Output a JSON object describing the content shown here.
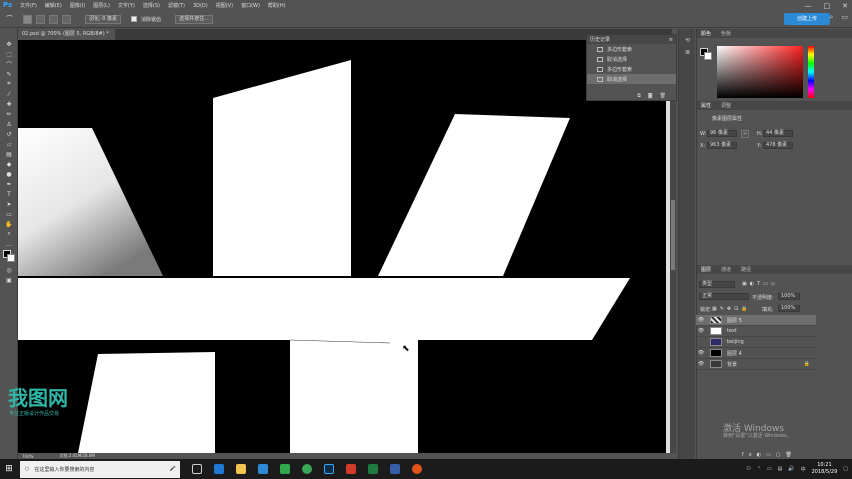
{
  "app": {
    "logo": "Ps"
  },
  "menu": [
    "文件(F)",
    "编辑(E)",
    "图像(I)",
    "图层(L)",
    "文字(Y)",
    "选择(S)",
    "滤镜(T)",
    "3D(D)",
    "视图(V)",
    "窗口(W)",
    "帮助(H)"
  ],
  "options": {
    "feather": "羽化: 0 像素",
    "antialias_label": "消除锯齿",
    "select_mask": "选择并遮住...",
    "cloud_button": "创建上传"
  },
  "document": {
    "tab": "02.psd @ 700% (图层 5, RGB/8#) *",
    "zoom": "700%",
    "doc_info": "文档:2.01M/28.6M"
  },
  "history": {
    "tabs": [
      "历史记录"
    ],
    "items": [
      {
        "label": "多边形套索",
        "icon": "lasso-icon",
        "selected": false
      },
      {
        "label": "取消选择",
        "icon": "doc-icon",
        "selected": false
      },
      {
        "label": "多边形套索",
        "icon": "lasso-icon",
        "selected": false
      },
      {
        "label": "取消选择",
        "icon": "doc-icon",
        "selected": true
      }
    ]
  },
  "color_panel": {
    "tabs": [
      "颜色",
      "色板"
    ]
  },
  "properties": {
    "tabs": [
      "属性",
      "调整"
    ],
    "heading": "像素图层属性",
    "w_label": "W:",
    "w_value": "96 像素",
    "h_label": "H:",
    "h_value": "44 像素",
    "x_label": "X:",
    "x_value": "963 像素",
    "y_label": "Y:",
    "y_value": "478 像素"
  },
  "layers": {
    "tabs": [
      "图层",
      "通道",
      "路径"
    ],
    "kind": "类型",
    "blend": "正常",
    "opacity_label": "不透明度:",
    "opacity": "100%",
    "lock_label": "锁定:",
    "fill_label": "填充:",
    "fill": "100%",
    "items": [
      {
        "name": "图层 5",
        "visible": true,
        "selected": true,
        "thumb": "#2a2a2a"
      },
      {
        "name": "text",
        "visible": true,
        "selected": false,
        "thumb": "#ffffff"
      },
      {
        "name": "beijing",
        "visible": false,
        "selected": false,
        "thumb": "#2e2b6a"
      },
      {
        "name": "图层 4",
        "visible": true,
        "selected": false,
        "thumb": "#000000"
      },
      {
        "name": "背景",
        "visible": true,
        "selected": false,
        "thumb": "#3a3a3a"
      }
    ]
  },
  "watermark": {
    "logo": "我图网",
    "tagline": "专注正版设计作品交易"
  },
  "activation": {
    "title": "激活 Windows",
    "subtitle": "转到\"设置\"以激活 Windows。"
  },
  "taskbar": {
    "search_placeholder": "在这里输入你要搜索的内容",
    "time": "10:21",
    "date": "2018/5/29"
  }
}
